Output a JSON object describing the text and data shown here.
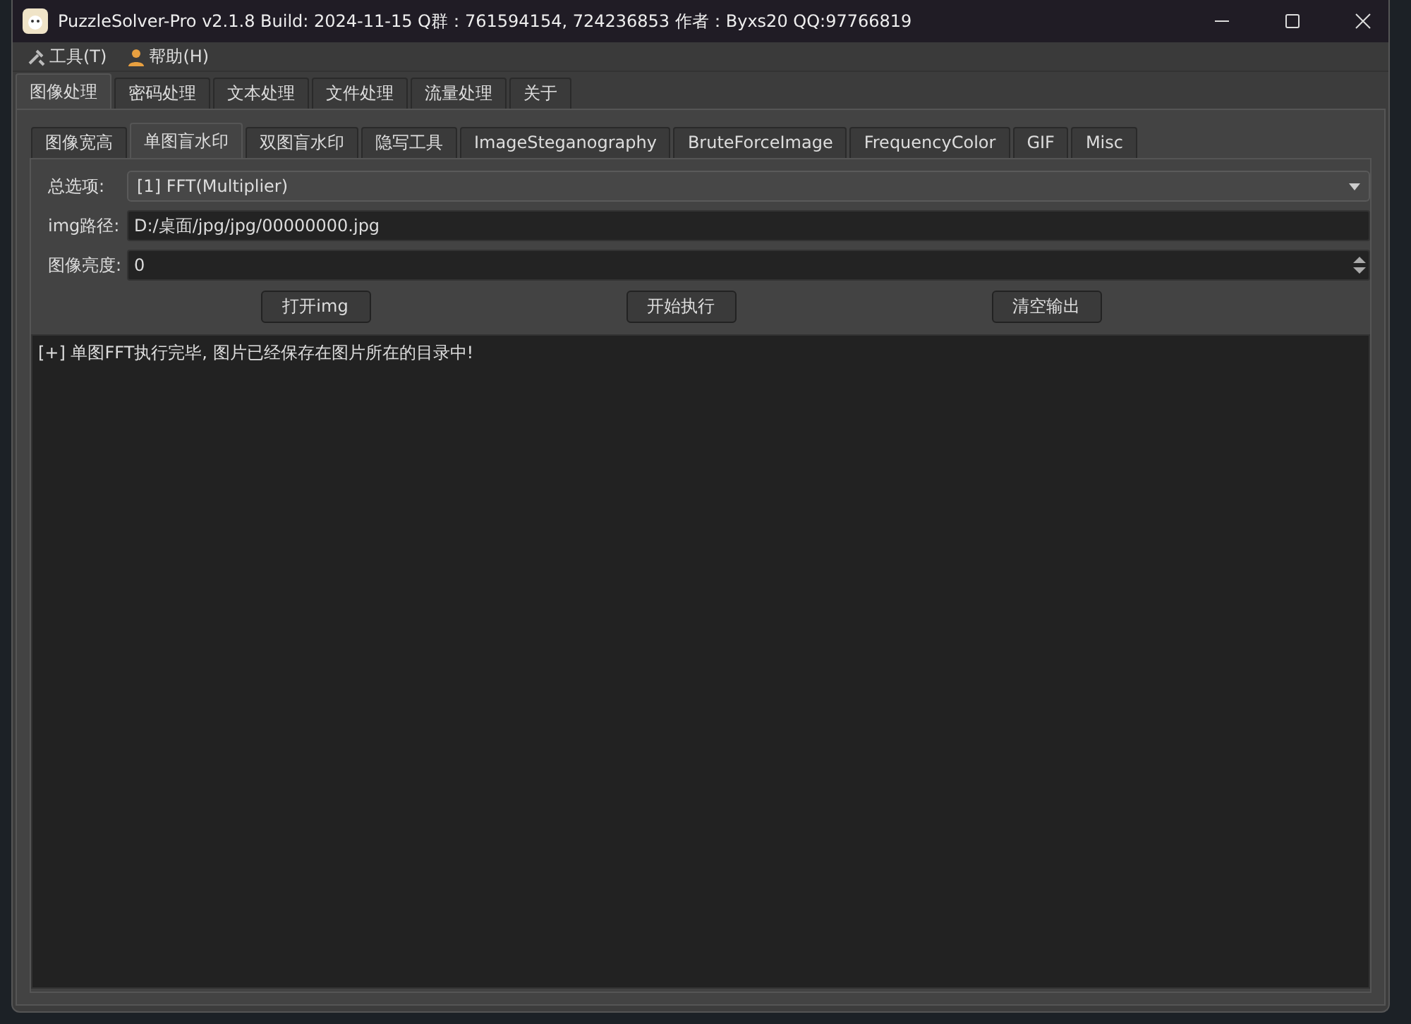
{
  "window": {
    "title": "PuzzleSolver-Pro v2.1.8  Build: 2024-11-15  Q群：761594154, 724236853  作者：Byxs20  QQ:97766819"
  },
  "menu": [
    {
      "label": "工具(T)",
      "kind": "tools"
    },
    {
      "label": "帮助(H)",
      "kind": "help"
    }
  ],
  "main_tabs": [
    {
      "label": "图像处理",
      "selected": true
    },
    {
      "label": "密码处理",
      "selected": false
    },
    {
      "label": "文本处理",
      "selected": false
    },
    {
      "label": "文件处理",
      "selected": false
    },
    {
      "label": "流量处理",
      "selected": false
    },
    {
      "label": "关于",
      "selected": false
    }
  ],
  "sub_tabs": [
    {
      "label": "图像宽高",
      "selected": false
    },
    {
      "label": "单图盲水印",
      "selected": true
    },
    {
      "label": "双图盲水印",
      "selected": false
    },
    {
      "label": "隐写工具",
      "selected": false
    },
    {
      "label": "ImageSteganography",
      "selected": false
    },
    {
      "label": "BruteForceImage",
      "selected": false
    },
    {
      "label": "FrequencyColor",
      "selected": false
    },
    {
      "label": "GIF",
      "selected": false
    },
    {
      "label": "Misc",
      "selected": false
    }
  ],
  "fields": [
    {
      "kind": "combo",
      "label": "总选项:",
      "value": "[1] FFT(Multiplier)"
    },
    {
      "kind": "text",
      "label": "img路径:",
      "value": "D:/桌面/jpg/jpg/00000000.jpg"
    },
    {
      "kind": "spin",
      "label": "图像亮度:",
      "value": "0"
    }
  ],
  "buttons": [
    "打开img",
    "开始执行",
    "清空输出"
  ],
  "output": [
    "[+] 单图FFT执行完毕, 图片已经保存在图片所在的目录中!"
  ]
}
